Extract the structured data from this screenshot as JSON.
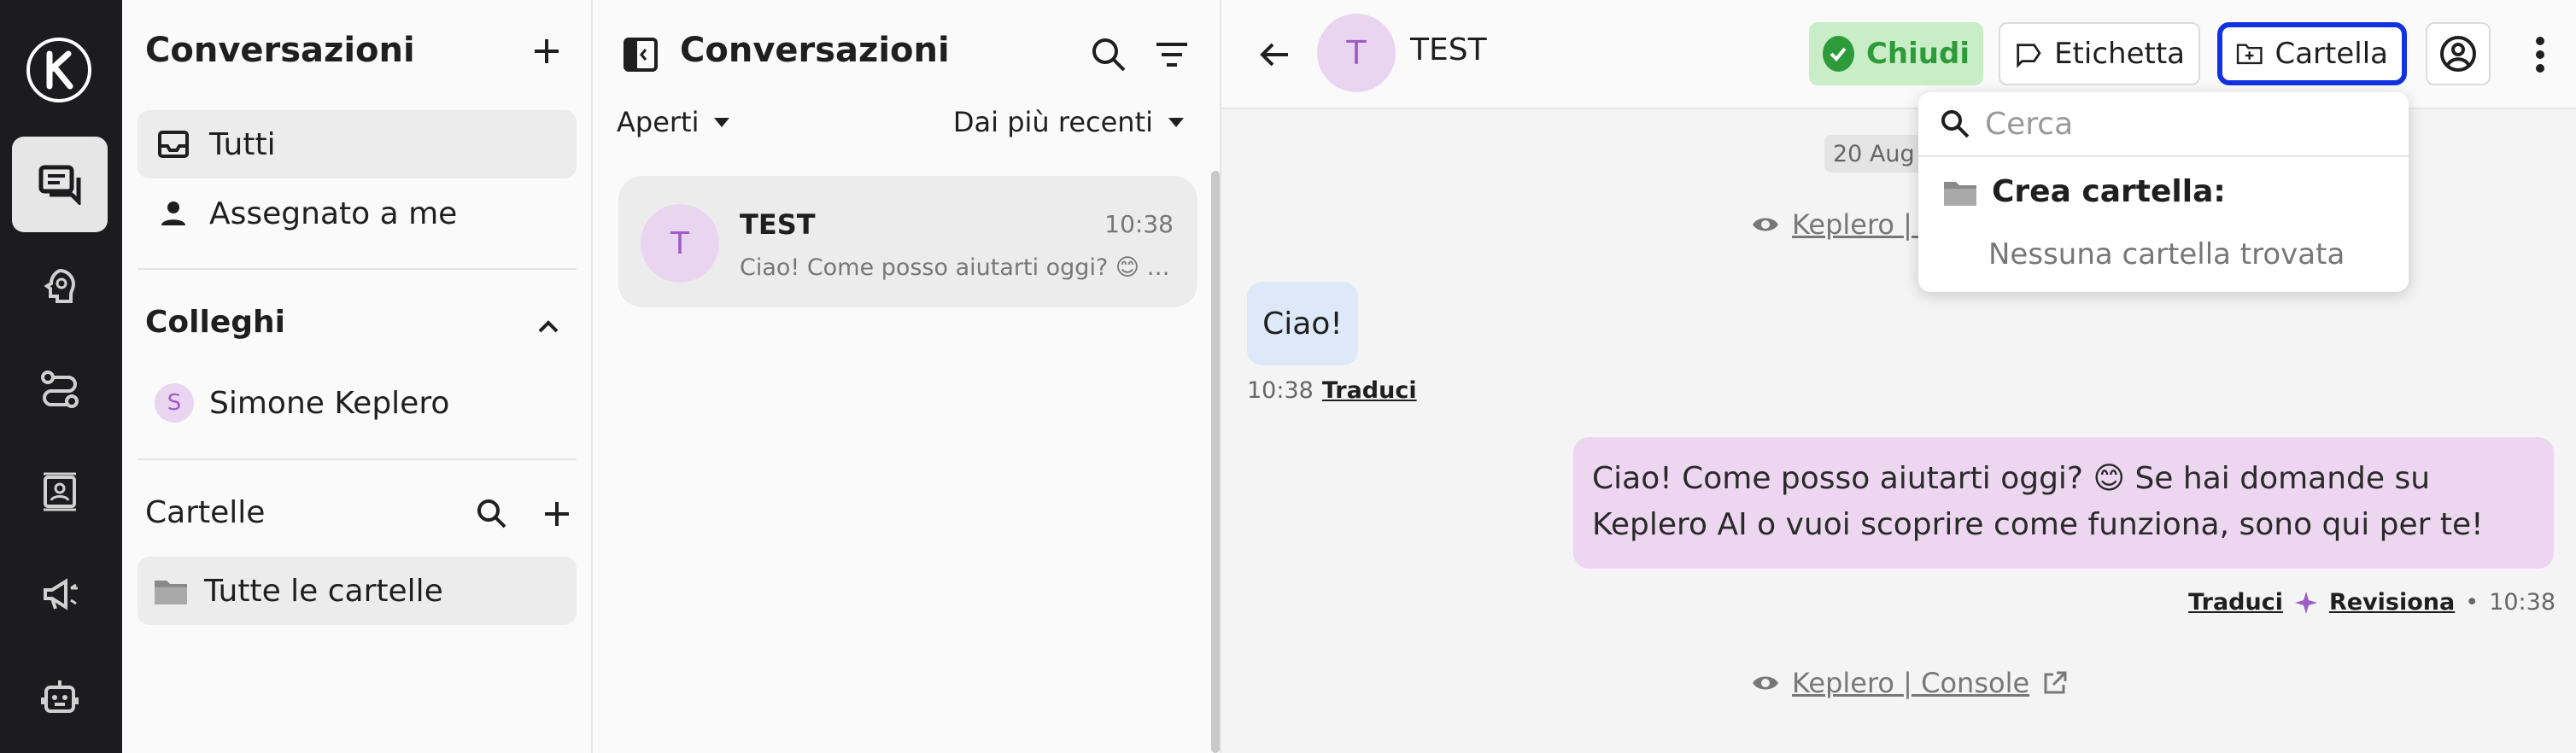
{
  "colors": {
    "rail_bg": "#1c1c1e",
    "avatar_bg": "#ead5f1",
    "avatar_fg": "#a15bc7",
    "close_bg": "#c9edc6",
    "close_fg": "#2e9b3a",
    "focus_ring": "#1132e0",
    "bubble_in": "#dde9f8",
    "bubble_out": "#ecd6f0"
  },
  "rail": {
    "items": [
      {
        "icon": "logo-icon"
      },
      {
        "icon": "chat-icon",
        "active": true
      },
      {
        "icon": "ai-agent-icon"
      },
      {
        "icon": "flows-icon"
      },
      {
        "icon": "contacts-icon"
      },
      {
        "icon": "megaphone-icon"
      },
      {
        "icon": "bot-icon"
      }
    ]
  },
  "sidebar": {
    "title": "Conversazioni",
    "items": [
      {
        "label": "Tutti",
        "icon": "inbox-icon",
        "selected": true
      },
      {
        "label": "Assegnato a me",
        "icon": "person-icon"
      }
    ],
    "colleagues": {
      "title": "Colleghi",
      "members": [
        {
          "initial": "S",
          "name": "Simone Keplero"
        }
      ]
    },
    "folders": {
      "title": "Cartelle",
      "all_label": "Tutte le cartelle"
    }
  },
  "list": {
    "title": "Conversazioni",
    "status_filter": "Aperti",
    "sort": "Dai più recenti",
    "conversations": [
      {
        "initial": "T",
        "name": "TEST",
        "time": "10:38",
        "preview": "Ciao! Come posso aiutarti oggi? 😊 Se hai domande su Keplero AI o vuoi scoprire come funziona, sono qui per te!"
      }
    ]
  },
  "chat": {
    "contact_initial": "T",
    "contact_name": "TEST",
    "close_label": "Chiudi",
    "label_label": "Etichetta",
    "folder_label": "Cartella",
    "date_chip": "20 Aug 2",
    "page_link_1": "Keplero | Console",
    "incoming": {
      "text": "Ciao!",
      "time": "10:38",
      "translate": "Traduci"
    },
    "outgoing": {
      "text": "Ciao! Come posso aiutarti oggi? 😊 Se hai domande su Keplero AI o vuoi scoprire come funziona, sono qui per te!",
      "translate": "Traduci",
      "review": "Revisiona",
      "time": "10:38"
    },
    "page_link_2": "Keplero | Console"
  },
  "folder_dropdown": {
    "search_placeholder": "Cerca",
    "create_label": "Crea cartella:",
    "empty_label": "Nessuna cartella trovata"
  }
}
